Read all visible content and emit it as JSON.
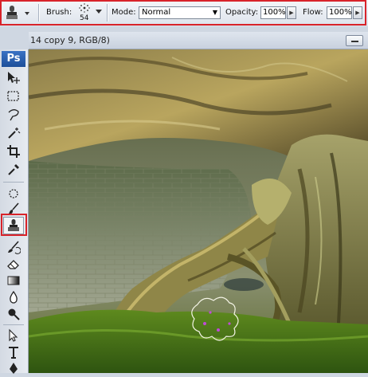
{
  "options_bar": {
    "brush_label": "Brush:",
    "brush_size": "54",
    "mode_label": "Mode:",
    "mode_value": "Normal",
    "opacity_label": "Opacity:",
    "opacity_value": "100%",
    "flow_label": "Flow:",
    "flow_value": "100%"
  },
  "document": {
    "title": "14 copy 9, RGB/8)"
  },
  "toolbox": {
    "logo": "Ps",
    "active_tool": "clone-stamp-tool"
  },
  "colors": {
    "highlight": "#d8232a",
    "logo_blue": "#2a60b0"
  }
}
